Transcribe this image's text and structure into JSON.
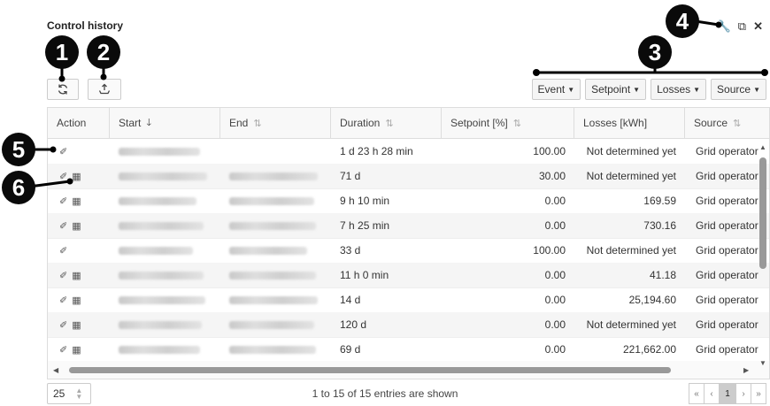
{
  "window": {
    "title": "Control history",
    "wrench_icon": "wrench-icon",
    "restore_icon": "window-restore-icon",
    "close_icon": "close-icon"
  },
  "toolbar": {
    "refresh_icon": "refresh-icon",
    "export_icon": "export-icon"
  },
  "filters": [
    {
      "label": "Event"
    },
    {
      "label": "Setpoint"
    },
    {
      "label": "Losses"
    },
    {
      "label": "Source"
    }
  ],
  "columns": {
    "action": "Action",
    "start": "Start",
    "end": "End",
    "duration": "Duration",
    "setpoint": "Setpoint [%]",
    "losses": "Losses [kWh]",
    "source": "Source"
  },
  "sort": {
    "column": "start",
    "direction": "descending"
  },
  "rows": [
    {
      "duration": "1 d 23 h 28 min",
      "setpoint": "100.00",
      "losses": "Not determined yet",
      "source": "Grid operator",
      "has_table_icon": false,
      "has_end": false
    },
    {
      "duration": "71 d",
      "setpoint": "30.00",
      "losses": "Not determined yet",
      "source": "Grid operator",
      "has_table_icon": true,
      "has_end": true
    },
    {
      "duration": "9 h 10 min",
      "setpoint": "0.00",
      "losses": "169.59",
      "source": "Grid operator",
      "has_table_icon": true,
      "has_end": true
    },
    {
      "duration": "7 h 25 min",
      "setpoint": "0.00",
      "losses": "730.16",
      "source": "Grid operator",
      "has_table_icon": true,
      "has_end": true
    },
    {
      "duration": "33 d",
      "setpoint": "100.00",
      "losses": "Not determined yet",
      "source": "Grid operator",
      "has_table_icon": false,
      "has_end": true
    },
    {
      "duration": "11 h 0 min",
      "setpoint": "0.00",
      "losses": "41.18",
      "source": "Grid operator",
      "has_table_icon": true,
      "has_end": true
    },
    {
      "duration": "14 d",
      "setpoint": "0.00",
      "losses": "25,194.60",
      "source": "Grid operator",
      "has_table_icon": true,
      "has_end": true
    },
    {
      "duration": "120 d",
      "setpoint": "0.00",
      "losses": "Not determined yet",
      "source": "Grid operator",
      "has_table_icon": true,
      "has_end": true
    },
    {
      "duration": "69 d",
      "setpoint": "0.00",
      "losses": "221,662.00",
      "source": "Grid operator",
      "has_table_icon": true,
      "has_end": true
    }
  ],
  "footer": {
    "page_size": "25",
    "info": "1 to 15 of 15 entries are shown",
    "pager": {
      "first": "«",
      "prev": "‹",
      "current": "1",
      "next": "›",
      "last": "»"
    }
  },
  "callouts": [
    "1",
    "2",
    "3",
    "4",
    "5",
    "6"
  ]
}
